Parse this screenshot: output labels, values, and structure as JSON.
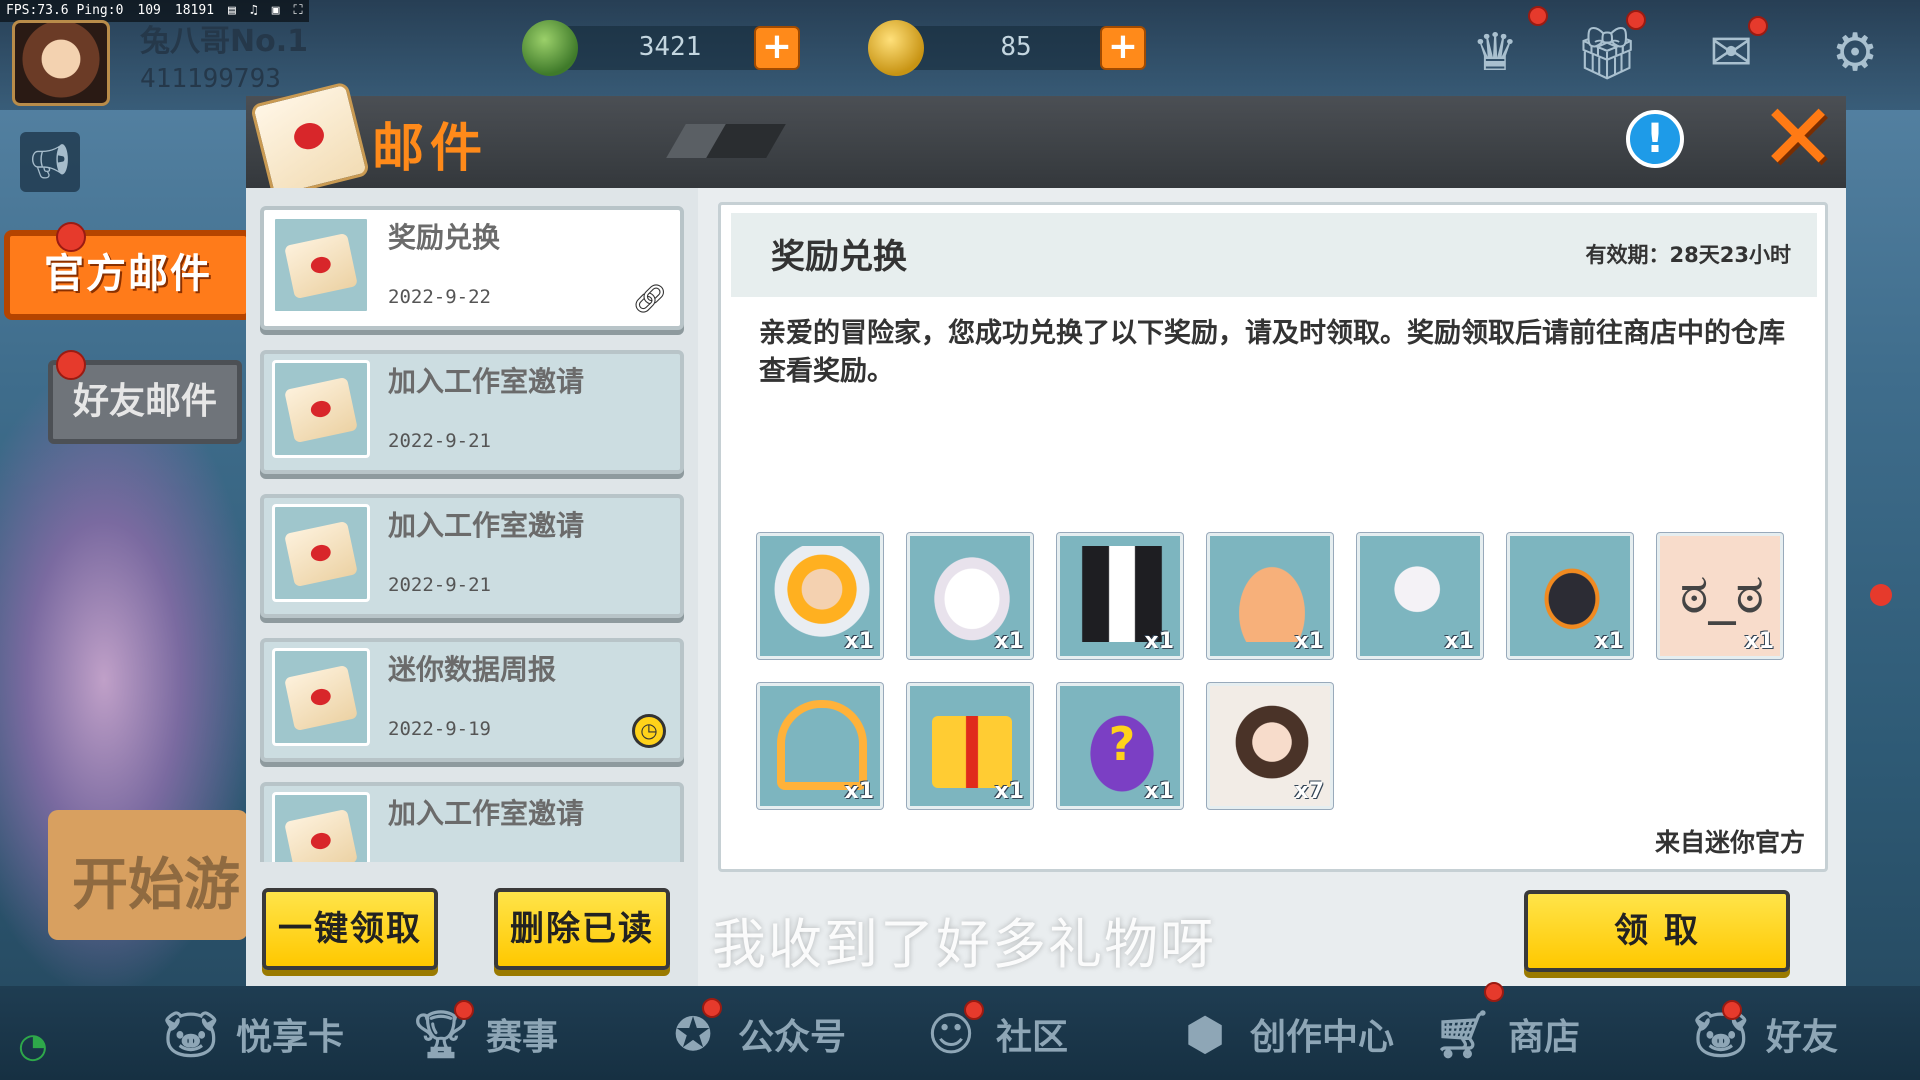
{
  "hud": {
    "fps_text": "FPS:73.6 Ping:0",
    "stat1": "109",
    "stat2": "18191"
  },
  "player": {
    "name": "兔八哥No.1",
    "id": "411199793"
  },
  "currency": {
    "gems": "3421",
    "coins": "85"
  },
  "left_tabs": {
    "official": "官方邮件",
    "friends": "好友邮件",
    "start_game": "开始游"
  },
  "dialog": {
    "title": "邮件",
    "info": "!",
    "close": "✕"
  },
  "mail_list": [
    {
      "title": "奖励兑换",
      "date": "2022-9-22",
      "marker": "attachment"
    },
    {
      "title": "加入工作室邀请",
      "date": "2022-9-21",
      "marker": ""
    },
    {
      "title": "加入工作室邀请",
      "date": "2022-9-21",
      "marker": ""
    },
    {
      "title": "迷你数据周报",
      "date": "2022-9-19",
      "marker": "clock"
    },
    {
      "title": "加入工作室邀请",
      "date": "",
      "marker": ""
    }
  ],
  "list_buttons": {
    "claim_all": "一键领取",
    "delete_read": "删除已读"
  },
  "detail": {
    "title": "奖励兑换",
    "expiry": "有效期：28天23小时",
    "body": "亲爱的冒险家，您成功兑换了以下奖励，请及时领取。奖励领取后请前往商店中的仓库查看奖励。",
    "from": "来自迷你官方",
    "claim": "领 取"
  },
  "rewards": [
    {
      "icon": "helmet-avatar-icon",
      "qty": "x1"
    },
    {
      "icon": "bunny-hair-icon",
      "qty": "x1"
    },
    {
      "icon": "jacket-icon",
      "qty": "x1"
    },
    {
      "icon": "skirt-icon",
      "qty": "x1"
    },
    {
      "icon": "mask-icon",
      "qty": "x1"
    },
    {
      "icon": "shoes-icon",
      "qty": "x1"
    },
    {
      "icon": "face-icon",
      "qty": "x1"
    },
    {
      "icon": "avatar-frame-icon",
      "qty": "x1"
    },
    {
      "icon": "gift-box-icon",
      "qty": "x1"
    },
    {
      "icon": "mystery-bag-icon",
      "qty": "x1"
    },
    {
      "icon": "character-card-icon",
      "qty": "x7"
    }
  ],
  "subtitle": "我收到了好多礼物呀",
  "bottom_nav": [
    "悦享卡",
    "赛事",
    "公众号",
    "社区",
    "创作中心",
    "商店",
    "好友"
  ],
  "colors": {
    "accent_orange": "#ff7b1a",
    "button_yellow": "#ffd21a",
    "panel_bg": "#e9edef",
    "red_dot": "#e63a2c"
  }
}
